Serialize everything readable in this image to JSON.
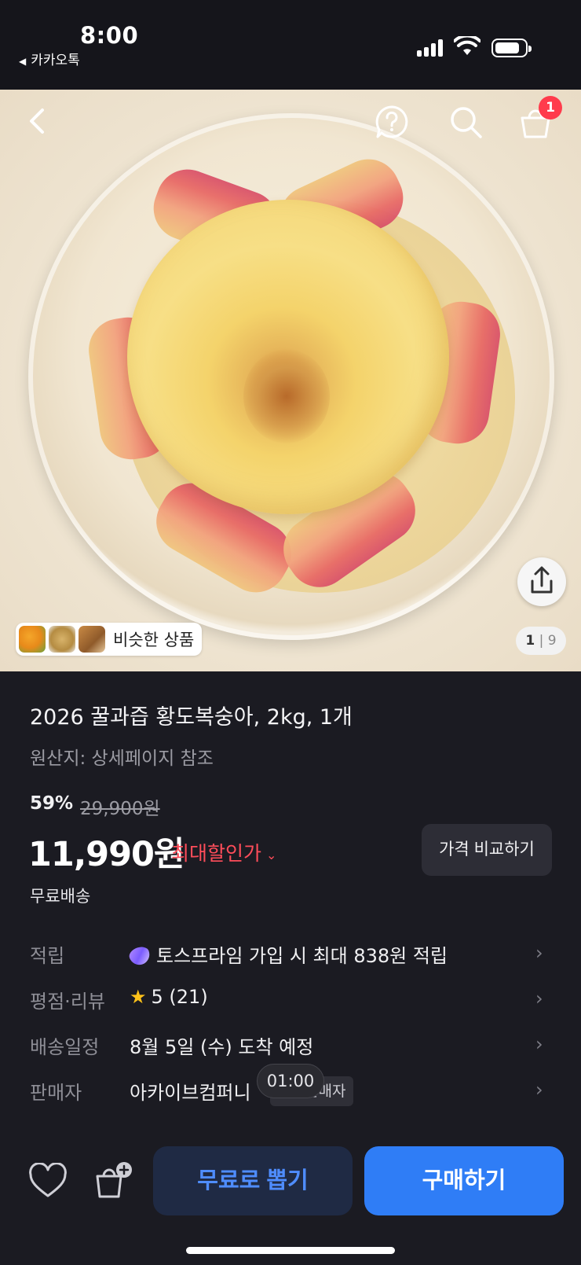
{
  "status_bar": {
    "time": "8:00",
    "back_app": "카카오톡"
  },
  "header": {
    "cart_count": "1"
  },
  "gallery": {
    "similar_label": "비슷한 상품",
    "current": "1",
    "total": "9",
    "separator": "|"
  },
  "product": {
    "title": "2026 꿀과즙 황도복숭아, 2kg, 1개",
    "origin": "원산지: 상세페이지 참조",
    "discount_rate": "59%",
    "original_price": "29,900원",
    "price": "11,990원",
    "max_discount_label": "최대할인가",
    "compare_button": "가격 비교하기",
    "shipping": "무료배송"
  },
  "details": [
    {
      "label": "적립",
      "value": "토스프라임 가입 시 최대 838원 적립"
    },
    {
      "label": "평점·리뷰",
      "value": "5 (21)"
    },
    {
      "label": "배송일정",
      "value": "8월 5일 (수) 도착 예정"
    },
    {
      "label": "판매자",
      "value": "아카이브컴퍼니"
    }
  ],
  "seller_badge": "판매자",
  "timer": "01:00",
  "bottom": {
    "free_draw_button": "무료로 뽑기",
    "buy_button": "구매하기"
  },
  "colors": {
    "accent": "#2f7df6",
    "discount": "#ff4d5a",
    "badge": "#ff3b4c",
    "background": "#1b1b22"
  }
}
